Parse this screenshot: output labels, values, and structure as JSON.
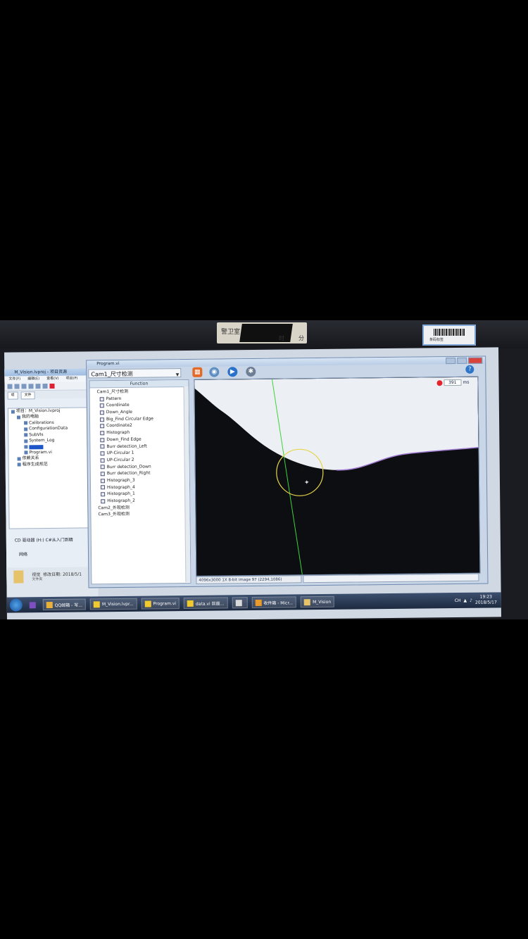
{
  "sticker_left": {
    "line1": "警卫室",
    "time": "时",
    "minute": "分"
  },
  "sticker_right": {
    "text": "条码标签"
  },
  "explorer": {
    "title": "M_Vision.lvproj - 项目资源",
    "menu": [
      "文件(F)",
      "编辑(E)",
      "查看(V)",
      "项目(P)"
    ],
    "tabs": [
      "项",
      "文件"
    ],
    "tree": [
      {
        "label": "项目：M_Vision.lvproj",
        "level": 0
      },
      {
        "label": "我的电脑",
        "level": 1
      },
      {
        "label": "Calibrations",
        "level": 2
      },
      {
        "label": "ConfigurationData",
        "level": 2
      },
      {
        "label": "SubVIs",
        "level": 2
      },
      {
        "label": "System_Log",
        "level": 2
      },
      {
        "label": "",
        "level": 2,
        "selected": true
      },
      {
        "label": "Program.vi",
        "level": 2
      },
      {
        "label": "依赖关系",
        "level": 1
      },
      {
        "label": "程序生成规范",
        "level": 1
      }
    ],
    "drive": "CD 驱动器 (H:) C#从入门到精",
    "network": "网络",
    "bottom_name": "视觉",
    "bottom_date": "修改日期: 2018/5/1",
    "bottom_type": "文件夹"
  },
  "program": {
    "title": "Program.vi",
    "camera_select": "Cam1_尺寸检测",
    "function_header": "Function",
    "functions": [
      {
        "label": "Cam1_尺寸检测",
        "top": true
      },
      {
        "label": "Pattern"
      },
      {
        "label": "Coordinate"
      },
      {
        "label": "Down_Angle"
      },
      {
        "label": "Big_Find Circular Edge"
      },
      {
        "label": "Coordinate2"
      },
      {
        "label": "Histograph"
      },
      {
        "label": "Down_Find Edge"
      },
      {
        "label": "Burr detection_Left"
      },
      {
        "label": "UP-Circular 1"
      },
      {
        "label": "UP-Circular 2"
      },
      {
        "label": "Burr detection_Down"
      },
      {
        "label": "Burr detection_Right"
      },
      {
        "label": "Histograph_3"
      },
      {
        "label": "Histograph_4"
      },
      {
        "label": "Histograph_1"
      },
      {
        "label": "Histograph_2"
      },
      {
        "label": "Cam2_外观检测",
        "top": true
      },
      {
        "label": "Cam3_外观检测",
        "top": true
      }
    ],
    "timing_value": "391",
    "timing_unit": "ms",
    "image_info": "4096x3000 1X 8-bit image 97  (2294,1086)",
    "help_icon": "?"
  },
  "taskbar": {
    "items": [
      {
        "label": "QQ邮箱 - 写...",
        "icon": "chrome-icon",
        "color": "#e9b13a"
      },
      {
        "label": "M_Vision.lvpr...",
        "icon": "labview-icon",
        "color": "#f0c830"
      },
      {
        "label": "Program.vi",
        "icon": "labview-vi-icon",
        "color": "#f0c830"
      },
      {
        "label": "data.vi 前面...",
        "icon": "labview-vi-icon",
        "color": "#f0c830"
      },
      {
        "label": "",
        "icon": "app-icon",
        "color": "#d9d9d9"
      },
      {
        "label": "收件箱 - Micr...",
        "icon": "outlook-icon",
        "color": "#e89b2b"
      },
      {
        "label": "M_Vision",
        "icon": "folder-icon",
        "color": "#e6c36a"
      }
    ],
    "tray_lang": "CH",
    "time": "19:23",
    "date": "2018/5/17"
  }
}
